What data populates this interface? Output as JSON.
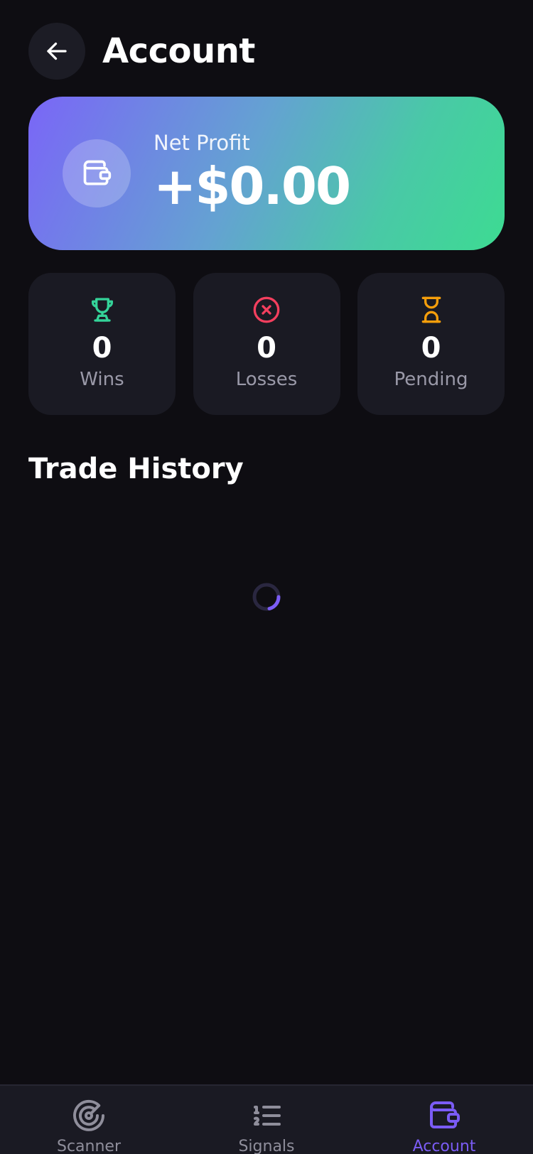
{
  "header": {
    "title": "Account"
  },
  "profit_card": {
    "label": "Net Profit",
    "value": "+$0.00"
  },
  "stats": [
    {
      "value": "0",
      "label": "Wins",
      "icon": "trophy-icon",
      "color": "#34d399"
    },
    {
      "value": "0",
      "label": "Losses",
      "icon": "x-circle-icon",
      "color": "#f43f5e"
    },
    {
      "value": "0",
      "label": "Pending",
      "icon": "hourglass-icon",
      "color": "#f59e0b"
    }
  ],
  "trade_history": {
    "title": "Trade History",
    "loading": true
  },
  "bottom_nav": {
    "items": [
      {
        "label": "Scanner",
        "icon": "radar-icon",
        "active": false
      },
      {
        "label": "Signals",
        "icon": "numbered-list-icon",
        "active": false
      },
      {
        "label": "Account",
        "icon": "wallet-icon",
        "active": true
      }
    ]
  },
  "colors": {
    "background": "#0e0d12",
    "card": "#1a1a23",
    "accent": "#7b5cf5",
    "muted_text": "#9a99a8"
  }
}
